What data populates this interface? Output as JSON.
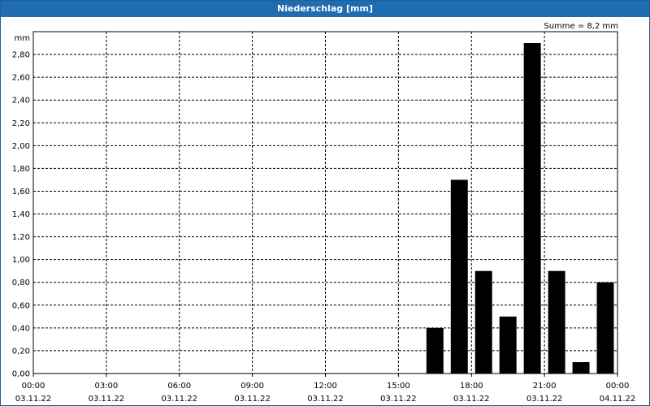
{
  "window": {
    "title": "Niederschlag [mm]"
  },
  "summary": "Summe = 8,2 mm",
  "chart_data": {
    "type": "bar",
    "title": "Niederschlag [mm]",
    "ylabel": "mm",
    "ylim": [
      0,
      3.0
    ],
    "y_ticks": [
      "0,00",
      "0,20",
      "0,40",
      "0,60",
      "0,80",
      "1,00",
      "1,20",
      "1,40",
      "1,60",
      "1,80",
      "2,00",
      "2,20",
      "2,40",
      "2,60",
      "2,80"
    ],
    "x_ticks": [
      {
        "time": "00:00",
        "date": "03.11.22"
      },
      {
        "time": "03:00",
        "date": "03.11.22"
      },
      {
        "time": "06:00",
        "date": "03.11.22"
      },
      {
        "time": "09:00",
        "date": "03.11.22"
      },
      {
        "time": "12:00",
        "date": "03.11.22"
      },
      {
        "time": "15:00",
        "date": "03.11.22"
      },
      {
        "time": "18:00",
        "date": "03.11.22"
      },
      {
        "time": "21:00",
        "date": "03.11.22"
      },
      {
        "time": "00:00",
        "date": "04.11.22"
      }
    ],
    "x_range_hours": [
      0,
      24
    ],
    "bar_width_hours": 0.7,
    "bars": [
      {
        "hour": 16.5,
        "value": 0.4
      },
      {
        "hour": 17.5,
        "value": 1.7
      },
      {
        "hour": 18.5,
        "value": 0.9
      },
      {
        "hour": 19.5,
        "value": 0.5
      },
      {
        "hour": 20.5,
        "value": 2.9
      },
      {
        "hour": 21.5,
        "value": 0.9
      },
      {
        "hour": 22.5,
        "value": 0.1
      },
      {
        "hour": 23.5,
        "value": 0.8
      }
    ],
    "grid": true,
    "bar_color": "#000000",
    "grid_color": "#000000"
  }
}
